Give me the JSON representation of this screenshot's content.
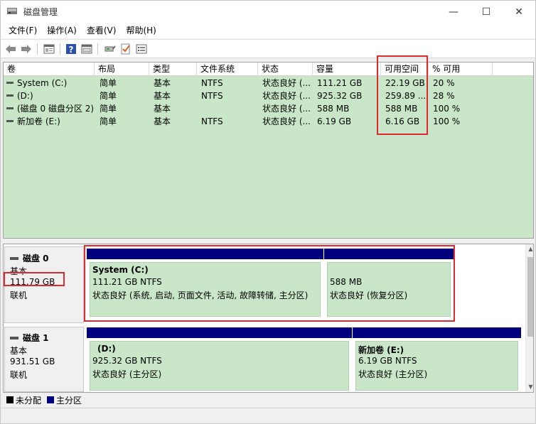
{
  "window": {
    "title": "磁盘管理",
    "minimize": "—",
    "maximize": "☐",
    "close": "✕"
  },
  "menu": [
    "文件(F)",
    "操作(A)",
    "查看(V)",
    "帮助(H)"
  ],
  "toolbar": [
    "back-arrow-icon",
    "forward-arrow-icon",
    "properties-icon",
    "help-icon",
    "view-icon",
    "connect-icon",
    "check-icon",
    "list-icon"
  ],
  "volume_table": {
    "headers": [
      "卷",
      "布局",
      "类型",
      "文件系统",
      "状态",
      "容量",
      "可用空间",
      "% 可用"
    ],
    "rows": [
      [
        "System (C:)",
        "简单",
        "基本",
        "NTFS",
        "状态良好 (...",
        "111.21 GB",
        "22.19 GB",
        "20 %"
      ],
      [
        "(D:)",
        "简单",
        "基本",
        "NTFS",
        "状态良好 (...",
        "925.32 GB",
        "259.89 ...",
        "28 %"
      ],
      [
        "(磁盘 0 磁盘分区 2)",
        "简单",
        "基本",
        "",
        "状态良好 (...",
        "588 MB",
        "588 MB",
        "100 %"
      ],
      [
        "新加卷 (E:)",
        "简单",
        "基本",
        "NTFS",
        "状态良好 (...",
        "6.19 GB",
        "6.16 GB",
        "100 %"
      ]
    ]
  },
  "disks": [
    {
      "name": "磁盘 0",
      "type": "基本",
      "size": "111.79 GB",
      "status": "联机",
      "partitions": [
        {
          "title": "System  (C:)",
          "size": "111.21 GB NTFS",
          "status": "状态良好 (系统, 启动, 页面文件, 活动, 故障转储, 主分区)"
        },
        {
          "title": "",
          "size": "588 MB",
          "status": "状态良好 (恢复分区)"
        }
      ]
    },
    {
      "name": "磁盘 1",
      "type": "基本",
      "size": "931.51 GB",
      "status": "联机",
      "partitions": [
        {
          "title": "(D:)",
          "size": "925.32 GB NTFS",
          "status": "状态良好 (主分区)"
        },
        {
          "title": "新加卷  (E:)",
          "size": "6.19 GB NTFS",
          "status": "状态良好 (主分区)"
        }
      ]
    }
  ],
  "legend": [
    {
      "label": "未分配",
      "color": "#000000"
    },
    {
      "label": "主分区",
      "color": "#00007f"
    }
  ],
  "colors": {
    "partition_bar": "#00007f",
    "partition_fill": "#c9e6c9",
    "annotation": "#e0282f"
  }
}
